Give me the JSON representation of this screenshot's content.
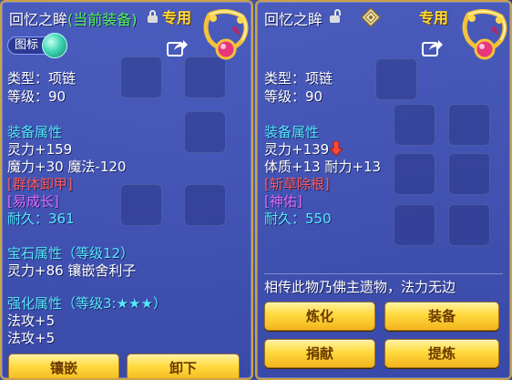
{
  "left": {
    "title": "回忆之眸",
    "equipped_label": "(当前装备)",
    "exclusive_tag": "专用",
    "badge_label": "图标",
    "type_line": "类型：项链",
    "level_line": "等级：90",
    "equip_attr_header": "装备属性",
    "spirit_line": "灵力+159",
    "magic_line": "魔力+30 魔法-120",
    "special_skill": "[群体卸甲]",
    "special_effect": "[易成长]",
    "durability_line": "耐久：361",
    "gem_header": "宝石属性（等级12）",
    "gem_line": "灵力+86 镶嵌舍利子",
    "forge_header": "强化属性（等级3:★★★）",
    "forge_line_1": "法攻+5",
    "forge_line_2": "法攻+5",
    "buttons": {
      "inlay": "镶嵌",
      "unequip": "卸下"
    }
  },
  "right": {
    "title": "回忆之眸",
    "exclusive_tag": "专用",
    "type_line": "类型：项链",
    "level_line": "等级：90",
    "equip_attr_header": "装备属性",
    "spirit_line": "灵力+139",
    "stats_line": "体质+13 耐力+13",
    "special_skill": "[斩草除根]",
    "special_effect": "[神佑]",
    "durability_line": "耐久：550",
    "description": "相传此物乃佛主遗物，法力无边",
    "buttons": {
      "refine": "炼化",
      "equip": "装备",
      "donate": "捐献",
      "extract": "提炼"
    }
  },
  "colors": {
    "panel_bg": "#4a5cbe",
    "border_gold": "#c9a24a",
    "header_cyan": "#55e8ff",
    "equipped_green": "#4ff25a",
    "skill_red": "#ff5a5a",
    "effect_pink": "#e06bff",
    "exclusive_gold": "#ffd83a"
  },
  "icons": [
    "lock-icon",
    "unlock-icon",
    "necklace-icon",
    "share-icon",
    "diamond-icon",
    "down-arrow-icon",
    "orb-icon"
  ]
}
